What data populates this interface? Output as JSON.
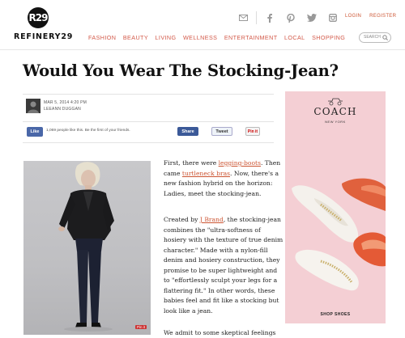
{
  "brand": {
    "logo_mark": "R29",
    "name": "REFINERY29"
  },
  "header": {
    "icons": [
      "mail-icon",
      "facebook-icon",
      "pinterest-icon",
      "twitter-icon",
      "instagram-icon"
    ],
    "login": "LOGIN",
    "register": "REGISTER",
    "search_placeholder": "SEARCH"
  },
  "nav": {
    "items": [
      {
        "label": "FASHION"
      },
      {
        "label": "BEAUTY"
      },
      {
        "label": "LIVING"
      },
      {
        "label": "WELLNESS"
      },
      {
        "label": "ENTERTAINMENT"
      },
      {
        "label": "LOCAL"
      },
      {
        "label": "SHOPPING"
      }
    ]
  },
  "article": {
    "title": "Would You Wear The Stocking-Jean?",
    "date": "MAR 5, 2014 4:20 PM",
    "author": "LEEANN DUGGAN",
    "fb_like": "Like",
    "fb_count_text": "1,069 people like this. Be the first of your friends.",
    "share_label": "Share",
    "tweet_label": "Tweet",
    "pin_label": "Pin it",
    "photo_pin_label": "Pin it",
    "para1": {
      "t1": "First, there were ",
      "link1": "legging-boots",
      "t2": ". Then came ",
      "link2": "turtleneck bras",
      "t3": ". Now, there's a new fashion hybrid on the horizon: Ladies, meet the stocking-jean."
    },
    "para2": {
      "t1": "Created by ",
      "link1": "J Brand",
      "t2": ", the stocking-jean combines the \"ultra-softness of hosiery with the texture of true denim character.\" Made with a nylon-fill denim and hosiery construction, they promise to be super lightweight and to \"effortlessly sculpt your legs for a flattering fit.\" In other words, these babies feel and fit like a stocking but look like a jean."
    },
    "para3": "We admit to some skeptical feelings"
  },
  "ad": {
    "brand": "COACH",
    "sub": "NEW YORK",
    "cta": "SHOP SHOES",
    "bg_color": "#f4cfd4"
  },
  "colors": {
    "accent": "#d35a4a"
  }
}
